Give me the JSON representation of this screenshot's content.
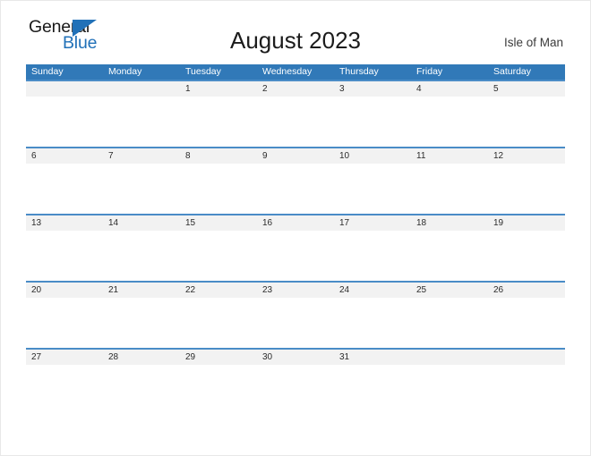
{
  "brand": {
    "name_part1": "General",
    "name_part2": "Blue",
    "triangle_icon": "triangle-flag-icon",
    "color_dark": "#1a1a1a",
    "color_blue": "#2171b8"
  },
  "header": {
    "title": "August 2023",
    "locale": "Isle of Man"
  },
  "theme": {
    "header_blue": "#3179b8",
    "rule_blue": "#4a8cc7",
    "strip_gray": "#f2f2f2"
  },
  "calendar": {
    "month": "August",
    "year": "2023",
    "weekday_headers": [
      "Sunday",
      "Monday",
      "Tuesday",
      "Wednesday",
      "Thursday",
      "Friday",
      "Saturday"
    ],
    "weeks": [
      [
        "",
        "",
        "1",
        "2",
        "3",
        "4",
        "5"
      ],
      [
        "6",
        "7",
        "8",
        "9",
        "10",
        "11",
        "12"
      ],
      [
        "13",
        "14",
        "15",
        "16",
        "17",
        "18",
        "19"
      ],
      [
        "20",
        "21",
        "22",
        "23",
        "24",
        "25",
        "26"
      ],
      [
        "27",
        "28",
        "29",
        "30",
        "31",
        "",
        ""
      ]
    ]
  }
}
